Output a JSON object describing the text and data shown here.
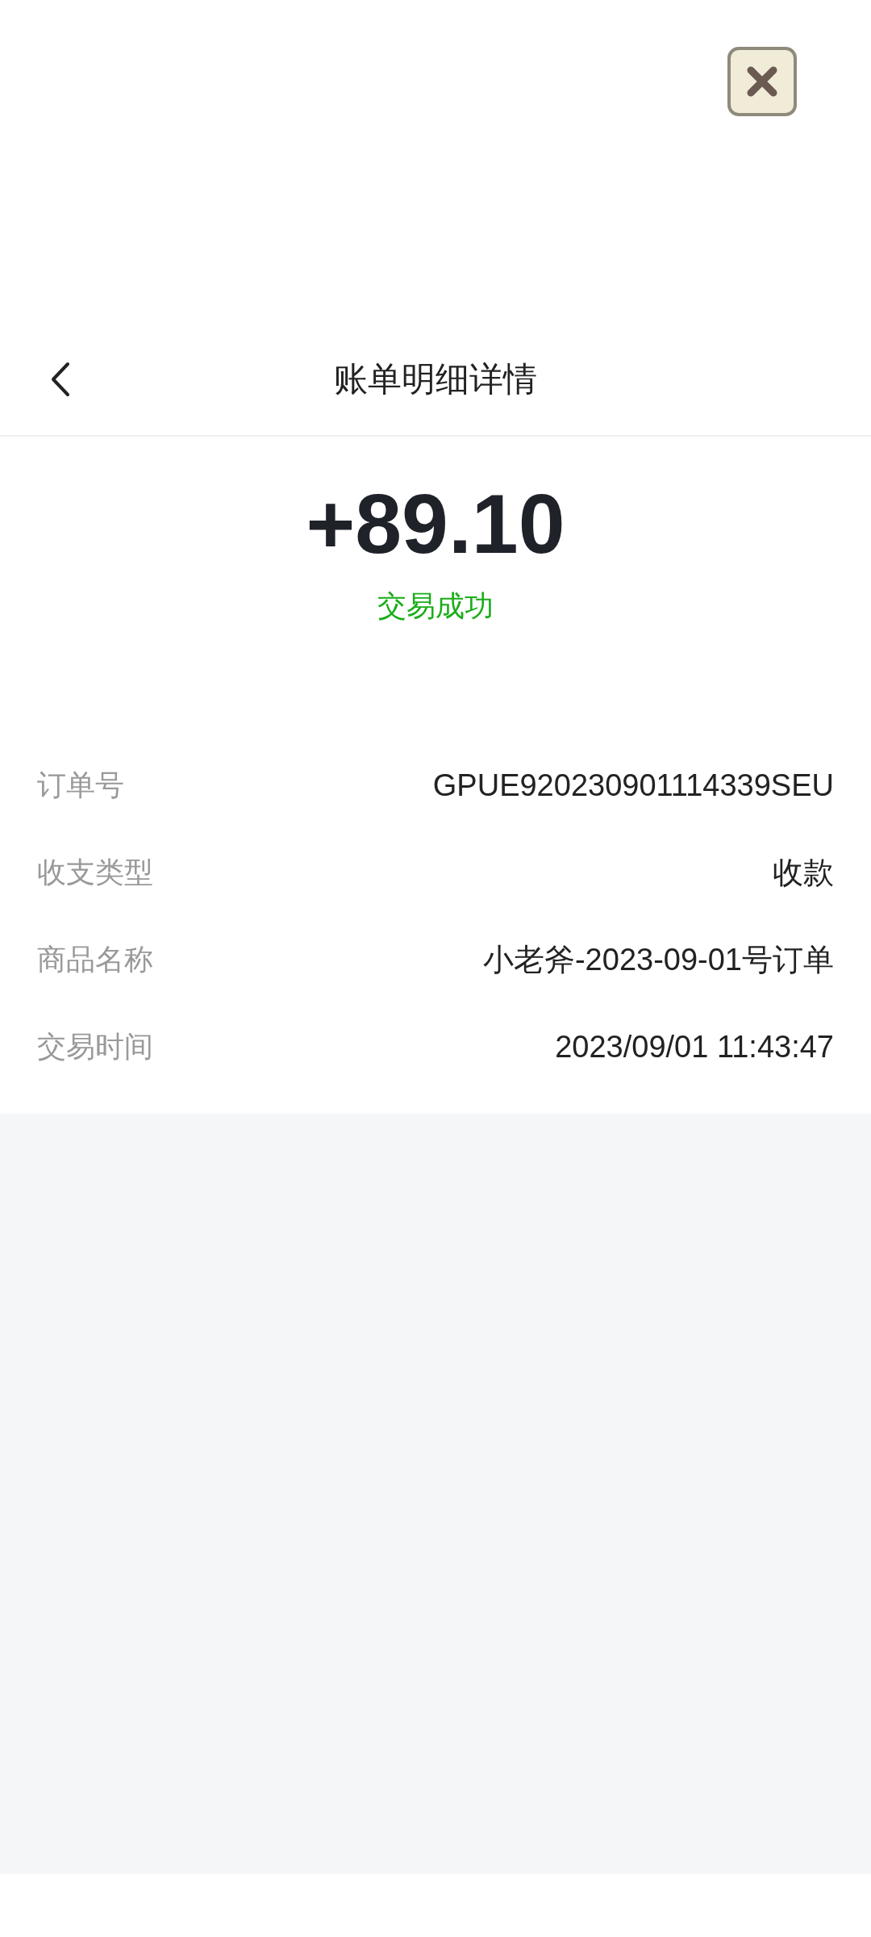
{
  "header": {
    "title": "账单明细详情"
  },
  "summary": {
    "amount": "+89.10",
    "status": "交易成功"
  },
  "details": [
    {
      "label": "订单号",
      "value": "GPUE920230901114339SEU"
    },
    {
      "label": "收支类型",
      "value": "收款"
    },
    {
      "label": "商品名称",
      "value": "小老斧-2023-09-01号订单"
    },
    {
      "label": "交易时间",
      "value": "2023/09/01 11:43:47"
    }
  ]
}
